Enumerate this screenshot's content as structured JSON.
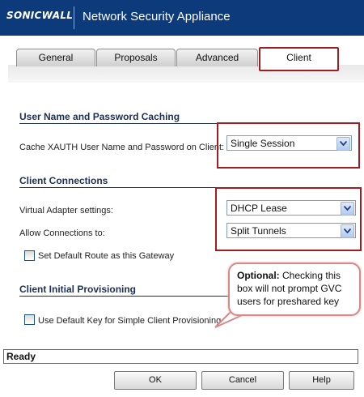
{
  "header": {
    "logo": "SONICWALL",
    "title": "Network Security Appliance"
  },
  "tabs": [
    {
      "label": "General"
    },
    {
      "label": "Proposals"
    },
    {
      "label": "Advanced"
    },
    {
      "label": "Client",
      "active": true
    }
  ],
  "sections": {
    "caching": {
      "title": "User Name and Password Caching",
      "cache_label": "Cache XAUTH User Name and Password on Client:",
      "cache_value": "Single Session"
    },
    "connections": {
      "title": "Client Connections",
      "adapter_label": "Virtual Adapter settings:",
      "adapter_value": "DHCP Lease",
      "allow_label": "Allow Connections to:",
      "allow_value": "Split Tunnels",
      "default_route_label": "Set Default Route as this Gateway",
      "default_route_checked": false
    },
    "provisioning": {
      "title": "Client Initial Provisioning",
      "default_key_label": "Use Default Key for Simple Client Provisioning",
      "default_key_checked": false
    }
  },
  "callout": {
    "bold": "Optional:",
    "text": " Checking this box will not prompt GVC users for preshared key"
  },
  "status": {
    "text": "Ready"
  },
  "buttons": {
    "ok": "OK",
    "cancel": "Cancel",
    "help": "Help"
  },
  "colors": {
    "header_bg": "#0c3a7a",
    "highlight_red": "#a01d22",
    "section_title": "#1d2f55"
  }
}
